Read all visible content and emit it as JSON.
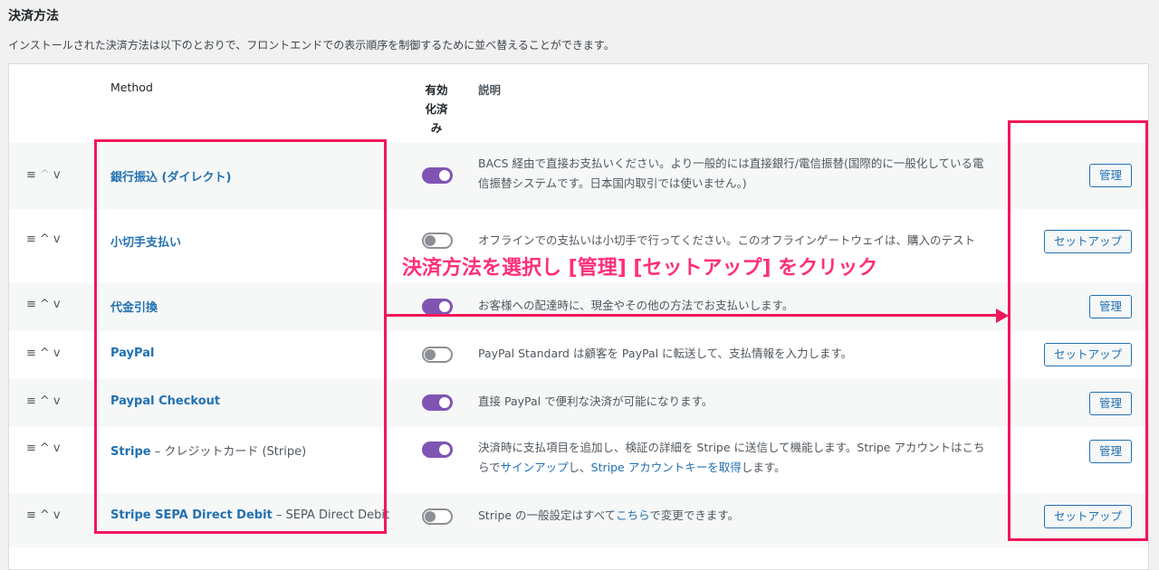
{
  "section": {
    "title": "決済方法",
    "description": "インストールされた決済方法は以下のとおりで、フロントエンドでの表示順序を制御するために並べ替えることができます。"
  },
  "columns": {
    "method": "Method",
    "enabled_line1": "有効",
    "enabled_line2": "化済",
    "enabled_line3": "み",
    "description": "説明"
  },
  "sort_glyphs": {
    "handle": "≡",
    "up": "^",
    "down": "v"
  },
  "rows": [
    {
      "name": "銀行振込 (ダイレクト)",
      "enabled": true,
      "desc_line1": "BACS 経由で直接お支払いください。より一般的には直接銀行/電信振替(国際的に一般化している電",
      "desc_line2": "信振替システムです。日本国内取引では使いません。)",
      "button": "管理"
    },
    {
      "name": "小切手支払い",
      "enabled": false,
      "desc_line1": "オフラインでの支払いは小切手で行ってください。このオフラインゲートウェイは、購入のテスト",
      "button": "セットアップ"
    },
    {
      "name": "代金引換",
      "enabled": true,
      "desc_line1": "お客様への配達時に、現金やその他の方法でお支払いします。",
      "button": "管理"
    },
    {
      "name": "PayPal",
      "enabled": false,
      "desc_line1": "PayPal Standard は顧客を PayPal に転送して、支払情報を入力します。",
      "button": "セットアップ"
    },
    {
      "name": "Paypal Checkout",
      "enabled": true,
      "desc_line1": "直接 PayPal で便利な決済が可能になります。",
      "button": "管理"
    },
    {
      "name": "Stripe",
      "name_sub": " – クレジットカード (Stripe)",
      "enabled": true,
      "desc_line1": "決済時に支払項目を追加し、検証の詳細を Stripe に送信して機能します。Stripe アカウントはこち",
      "desc_line2_pre": "らで",
      "desc_line2_link1": "サインアップ",
      "desc_line2_mid": "し、",
      "desc_line2_link2": "Stripe アカウントキーを取得",
      "desc_line2_post": "します。",
      "button": "管理"
    },
    {
      "name": "Stripe SEPA Direct Debit",
      "name_sub": " – SEPA Direct Debit",
      "enabled": false,
      "desc_pre": "Stripe の一般設定はすべて",
      "desc_link": "こちら",
      "desc_post": "で変更できます。",
      "button": "セットアップ"
    }
  ],
  "annotation": {
    "callout": "決済方法を選択し [管理] [セットアップ] をクリック",
    "color": "#f0185a"
  },
  "colors": {
    "toggle_on": "#7f54b3",
    "link": "#2271b1"
  }
}
